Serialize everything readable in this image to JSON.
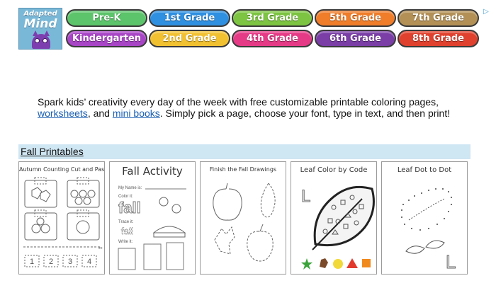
{
  "ad": {
    "logo_line1": "Adapted",
    "logo_line2": "Mind",
    "choices_icon": "ad-choices-icon",
    "grades": [
      {
        "label": "Pre-K",
        "color": "#5cc46a"
      },
      {
        "label": "1st Grade",
        "color": "#2f8fe0"
      },
      {
        "label": "3rd Grade",
        "color": "#7cc441"
      },
      {
        "label": "5th Grade",
        "color": "#ef7d2a"
      },
      {
        "label": "7th Grade",
        "color": "#b39056"
      },
      {
        "label": "Kindergarten",
        "color": "#a845c6"
      },
      {
        "label": "2nd Grade",
        "color": "#f2c131"
      },
      {
        "label": "4th Grade",
        "color": "#e53a86"
      },
      {
        "label": "6th Grade",
        "color": "#7a3ea6"
      },
      {
        "label": "8th Grade",
        "color": "#e0412e"
      }
    ]
  },
  "intro": {
    "text_before": "Spark kids’ creativity every day of the week with free customizable printable coloring pages, ",
    "link_worksheets": "worksheets",
    "text_middle": ", and ",
    "link_mini_books": "mini books",
    "text_after": ". Simply pick a page, choose your font, type in text, and then print!"
  },
  "section": {
    "title": "Fall Printables",
    "color": "#cfe6f3"
  },
  "cards": [
    {
      "title": "Autumn Counting Cut and Paste",
      "numbers": [
        "1",
        "2",
        "3",
        "4"
      ]
    },
    {
      "title": "Fall Activity",
      "name_label": "My Name is:",
      "color_label": "Color it:",
      "word": "fall",
      "trace_label": "Trace it:",
      "trace_word": "fall",
      "write_label": "Write it:"
    },
    {
      "title": "Finish the Fall Drawings"
    },
    {
      "title": "Leaf Color by Code",
      "letter": "L"
    },
    {
      "title": "Leaf Dot to Dot",
      "letter": "L"
    }
  ]
}
